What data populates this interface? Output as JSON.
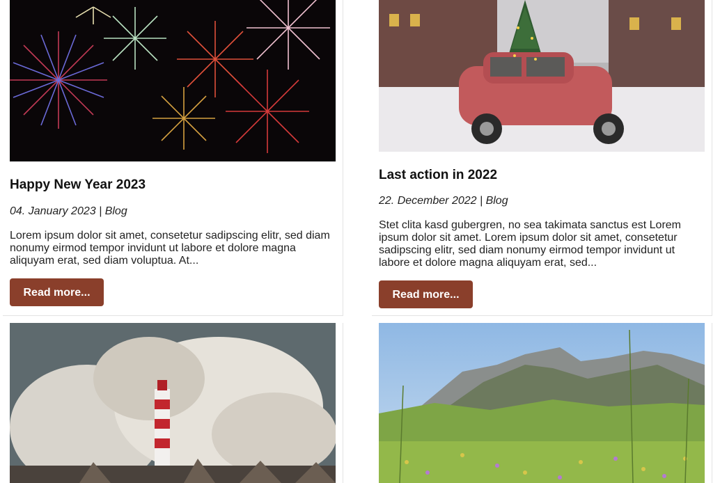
{
  "posts": [
    {
      "title": "Happy New Year 2023",
      "meta": "04. January 2023 | Blog",
      "excerpt": "Lorem ipsum dolor sit amet, consetetur sadipscing elitr, sed diam nonumy eirmod tempor invidunt ut labore et dolore magna aliquyam erat, sed diam voluptua. At...",
      "button": "Read more...",
      "image": "fireworks-image"
    },
    {
      "title": "Last action in 2022",
      "meta": "22. December 2022 | Blog",
      "excerpt": "Stet clita kasd gubergren, no sea takimata sanctus est Lorem ipsum dolor sit amet. Lorem ipsum dolor sit amet, consetetur sadipscing elitr, sed diam nonumy eirmod tempor invidunt ut labore et dolore magna aliquyam erat, sed...",
      "button": "Read more...",
      "image": "christmas-car-image"
    },
    {
      "image": "lighthouse-waves-image"
    },
    {
      "image": "mountain-meadow-image"
    }
  ],
  "colors": {
    "button_bg": "#8a3f2b",
    "button_text": "#ffffff"
  }
}
